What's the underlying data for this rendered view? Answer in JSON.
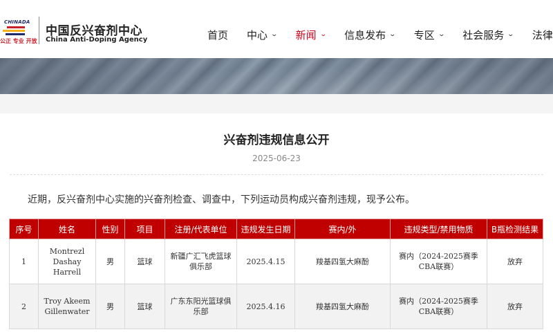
{
  "header": {
    "logo_brand": "CHINADA",
    "logo_slogan": "公正 专业 开放",
    "logo_cn": "中国反兴奋剂中心",
    "logo_en": "China Anti-Doping Agency",
    "nav": [
      {
        "label": "首页",
        "has_menu": false,
        "active": false
      },
      {
        "label": "中心",
        "has_menu": true,
        "active": false
      },
      {
        "label": "新闻",
        "has_menu": true,
        "active": true
      },
      {
        "label": "信息发布",
        "has_menu": true,
        "active": false
      },
      {
        "label": "专区",
        "has_menu": true,
        "active": false
      },
      {
        "label": "社会服务",
        "has_menu": true,
        "active": false
      },
      {
        "label": "法律",
        "has_menu": false,
        "active": false
      }
    ]
  },
  "article": {
    "title": "兴奋剂违规信息公开",
    "date": "2025-06-23",
    "intro": "近期，反兴奋剂中心实施的兴奋剂检查、调查中，下列运动员构成兴奋剂违规，现予公布。"
  },
  "table": {
    "headers": [
      "序号",
      "姓名",
      "性别",
      "项目",
      "注册/代表单位",
      "违规发生日期",
      "赛内/外",
      "违规类型/禁用物质",
      "B瓶检测结果"
    ],
    "rows": [
      [
        "1",
        "Montrezl Dashay Harrell",
        "男",
        "篮球",
        "新疆广汇飞虎篮球俱乐部",
        "2025.4.15",
        "羧基四氢大麻酚",
        "赛内（2024-2025赛季CBA联赛）",
        "放弃"
      ],
      [
        "2",
        "Troy Akeem Gillenwater",
        "男",
        "篮球",
        "广东东阳光篮球俱乐部",
        "2025.4.16",
        "羧基四氢大麻酚",
        "赛内（2024-2025赛季CBA联赛）",
        "放弃"
      ]
    ]
  },
  "colors": {
    "accent_red": "#c00000",
    "nav_active": "#d0021b"
  }
}
